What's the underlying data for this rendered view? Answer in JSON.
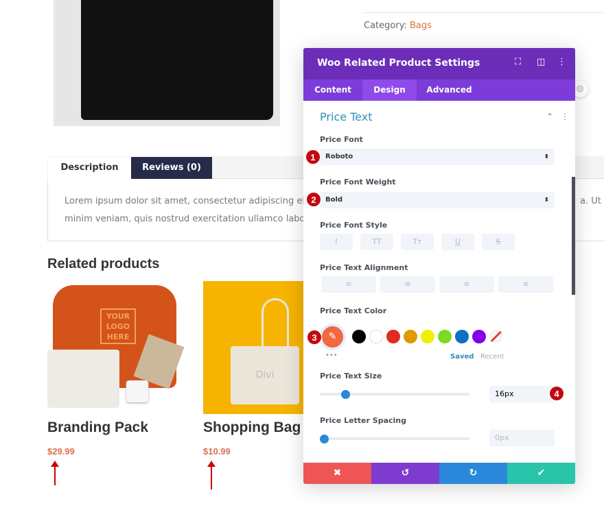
{
  "page": {
    "category_label": "Category:",
    "category_value": "Bags",
    "tabs": [
      {
        "label": "Description"
      },
      {
        "label": "Reviews (0)"
      }
    ],
    "description_line1": "Lorem ipsum dolor sit amet, consectetur adipiscing elit, se",
    "description_line1_right": "a. Ut en",
    "description_line2": "minim veniam, quis nostrud exercitation ullamco laboris n",
    "related_title": "Related products",
    "products": [
      {
        "name": "Branding Pack",
        "price": "$29.99",
        "logo_text": "YOUR LOGO HERE"
      },
      {
        "name": "Shopping Bag",
        "price": "$10.99",
        "logo_text": "Divi"
      }
    ]
  },
  "panel": {
    "title": "Woo Related Product Settings",
    "tabs": [
      {
        "label": "Content"
      },
      {
        "label": "Design",
        "active": true
      },
      {
        "label": "Advanced"
      }
    ],
    "section_title": "Price Text",
    "price_font_label": "Price Font",
    "price_font_value": "Roboto",
    "price_font_weight_label": "Price Font Weight",
    "price_font_weight_value": "Bold",
    "price_font_style_label": "Price Font Style",
    "font_style_buttons": [
      "I",
      "TT",
      "Tт",
      "U",
      "S"
    ],
    "price_text_alignment_label": "Price Text Alignment",
    "price_text_color_label": "Price Text Color",
    "selected_color": "#f2683f",
    "swatches": [
      "#000000",
      "#ffffff",
      "#e02b20",
      "#e09900",
      "#edf000",
      "#7cda24",
      "#0c71c3",
      "#8300e9"
    ],
    "saved_label": "Saved",
    "recent_label": "Recent",
    "price_text_size_label": "Price Text Size",
    "price_text_size_value": "16px",
    "price_text_size_slider_percent": 17,
    "price_letter_spacing_label": "Price Letter Spacing",
    "price_letter_spacing_placeholder": "0px",
    "price_letter_spacing_slider_percent": 0,
    "footer_colors": {
      "cancel": "#ef5555",
      "undo": "#7e3bd0",
      "redo": "#2b87da",
      "save": "#29c4a9"
    }
  },
  "annotations": [
    "1",
    "2",
    "3",
    "4"
  ]
}
